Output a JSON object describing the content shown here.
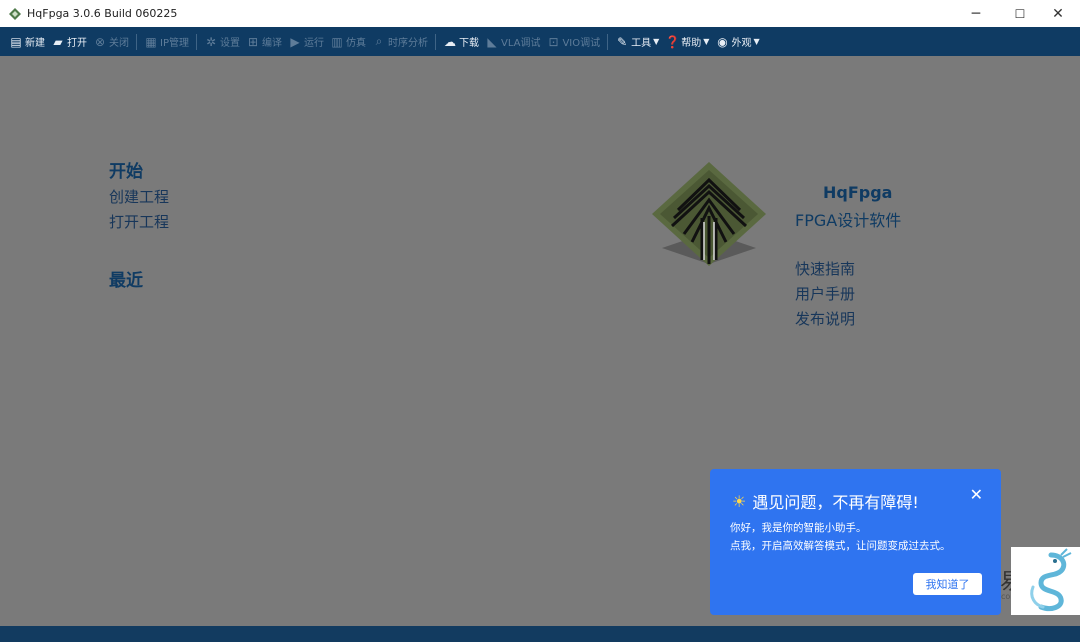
{
  "window": {
    "title": "HqFpga 3.0.6 Build 060225",
    "controls": [
      "minimize-icon",
      "maximize-icon",
      "close-icon"
    ]
  },
  "toolbar": {
    "items": [
      {
        "label": "新建",
        "icon": "new-file-icon",
        "enabled": true
      },
      {
        "label": "打开",
        "icon": "open-folder-icon",
        "enabled": true
      },
      {
        "label": "关闭",
        "icon": "close-circle-icon",
        "enabled": false
      },
      {
        "label": "IP管理",
        "icon": "ip-manage-icon",
        "enabled": false
      },
      {
        "label": "设置",
        "icon": "gear-icon",
        "enabled": false
      },
      {
        "label": "编译",
        "icon": "compile-icon",
        "enabled": false
      },
      {
        "label": "运行",
        "icon": "run-icon",
        "enabled": false
      },
      {
        "label": "仿真",
        "icon": "simulate-icon",
        "enabled": false
      },
      {
        "label": "时序分析",
        "icon": "timing-search-icon",
        "enabled": false
      },
      {
        "label": "下载",
        "icon": "download-cloud-icon",
        "enabled": true
      },
      {
        "label": "VLA调试",
        "icon": "vla-debug-icon",
        "enabled": false
      },
      {
        "label": "VIO调试",
        "icon": "vio-debug-icon",
        "enabled": false
      },
      {
        "label": "工具",
        "icon": "wrench-icon",
        "enabled": true,
        "dropdown": true
      },
      {
        "label": "帮助",
        "icon": "help-icon",
        "enabled": true,
        "dropdown": true
      },
      {
        "label": "外观",
        "icon": "eye-icon",
        "enabled": true,
        "dropdown": true
      }
    ]
  },
  "start": {
    "heading": "开始",
    "create": "创建工程",
    "open": "打开工程"
  },
  "recent": {
    "heading": "最近"
  },
  "about": {
    "name": "HqFpga",
    "subtitle": "FPGA设计软件",
    "links": [
      "快速指南",
      "用户手册",
      "发布说明"
    ]
  },
  "assistant": {
    "title": "遇见问题，不再有障碍!",
    "line1": "你好，我是你的智能小助手。",
    "line2": "点我，开启高效解答模式，让问题变成过去式。",
    "ok": "我知道了"
  },
  "colors": {
    "toolbar": "#0f3b63",
    "background": "#7a7a7a",
    "popup": "#2f74f0",
    "heading": "#0f3b63"
  }
}
